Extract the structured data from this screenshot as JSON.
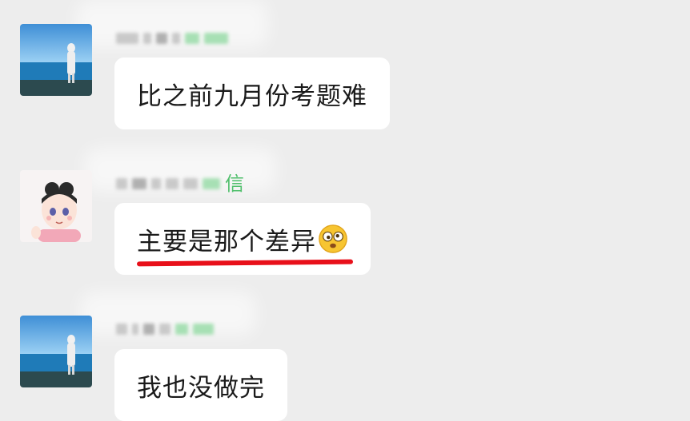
{
  "messages": [
    {
      "avatar": "seaside-person-avatar",
      "name_suffix": "",
      "text": "比之前九月份考题难",
      "underlined": false
    },
    {
      "avatar": "anime-girl-avatar",
      "name_suffix": "信",
      "text": "主要是那个差异",
      "underlined": true,
      "emoji": "dizzy-face-emoji"
    },
    {
      "avatar": "seaside-person-avatar",
      "name_suffix": "",
      "text": "我也没做完",
      "underlined": false
    }
  ],
  "colors": {
    "background": "#ededed",
    "bubble": "#ffffff",
    "underline": "#e8101a",
    "name_green": "#4fbf6b"
  }
}
